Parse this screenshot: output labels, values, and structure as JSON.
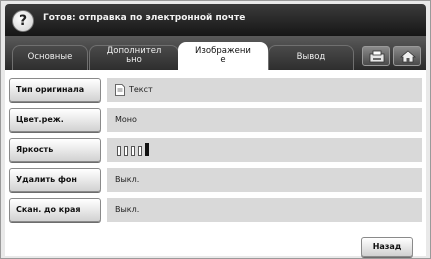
{
  "title": {
    "text": "Готов: отправка по электронной почте",
    "help_label": "?"
  },
  "tabs": [
    {
      "label": "Основные",
      "active": false
    },
    {
      "label": "Дополнител\nьно",
      "active": false
    },
    {
      "label": "Изображени\nе",
      "active": true
    },
    {
      "label": "Вывод",
      "active": false
    }
  ],
  "toolbar_icons": [
    "job-status-icon",
    "home-icon"
  ],
  "settings": [
    {
      "label": "Тип оригинала",
      "value": "Текст",
      "icon": "text-document-icon"
    },
    {
      "label": "Цвет.реж.",
      "value": "Моно"
    },
    {
      "label": "Яркость",
      "value": "",
      "brightness": {
        "levels": 5,
        "selected": 5
      }
    },
    {
      "label": "Удалить фон",
      "value": "Выкл."
    },
    {
      "label": "Скан. до края",
      "value": "Выкл."
    }
  ],
  "back_label": "Назад"
}
